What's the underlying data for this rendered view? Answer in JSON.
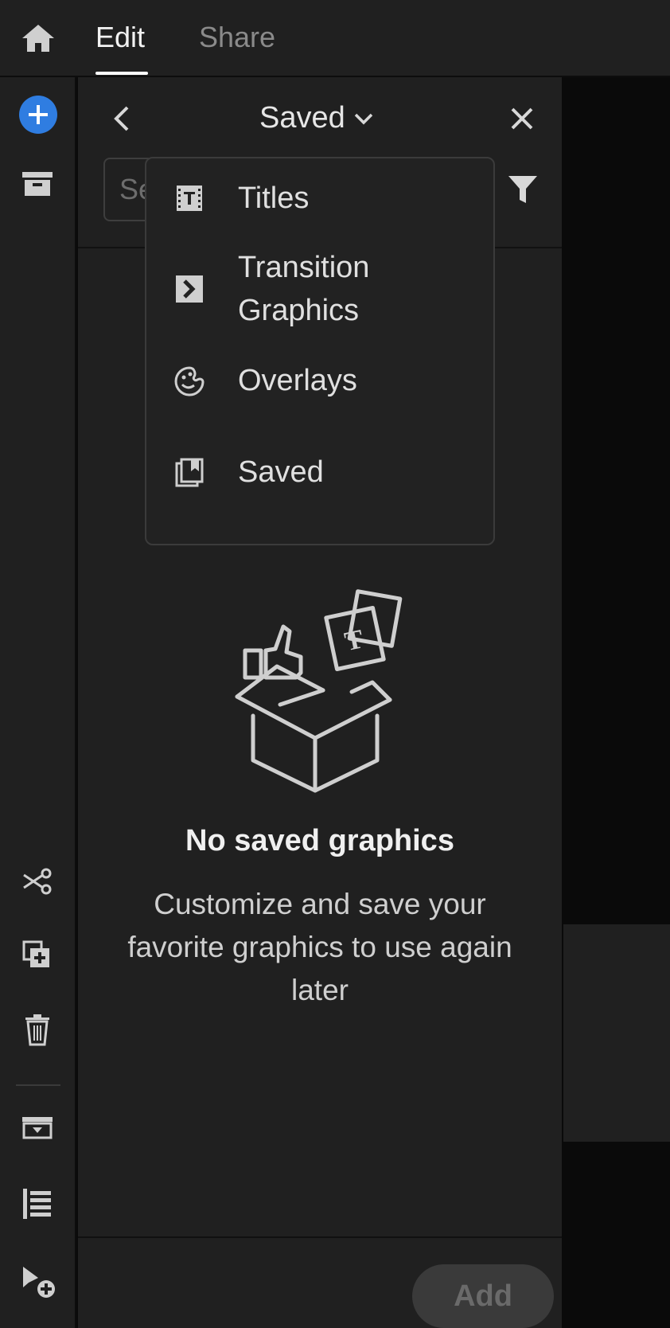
{
  "topbar": {
    "home_icon": "home-icon",
    "tabs": [
      {
        "label": "Edit",
        "active": true
      },
      {
        "label": "Share",
        "active": false
      }
    ]
  },
  "leftrail": {
    "icons": [
      "add-icon",
      "media-bin-icon",
      "scissors-icon",
      "duplicate-icon",
      "trash-icon",
      "storage-icon",
      "align-left-icon",
      "pointer-add-icon"
    ],
    "accent_color": "#2f7de1"
  },
  "panel": {
    "title": "Saved",
    "search_placeholder": "Se",
    "empty_title": "No saved graphics",
    "empty_description": "Customize and save your favorite graphics to use again later",
    "add_label": "Add"
  },
  "dropdown": {
    "items": [
      {
        "label": "Titles",
        "icon": "titles-icon"
      },
      {
        "label": "Transition\nGraphics",
        "icon": "transition-icon"
      },
      {
        "label": "Overlays",
        "icon": "overlays-icon"
      },
      {
        "label": "Saved",
        "icon": "saved-icon"
      }
    ]
  }
}
